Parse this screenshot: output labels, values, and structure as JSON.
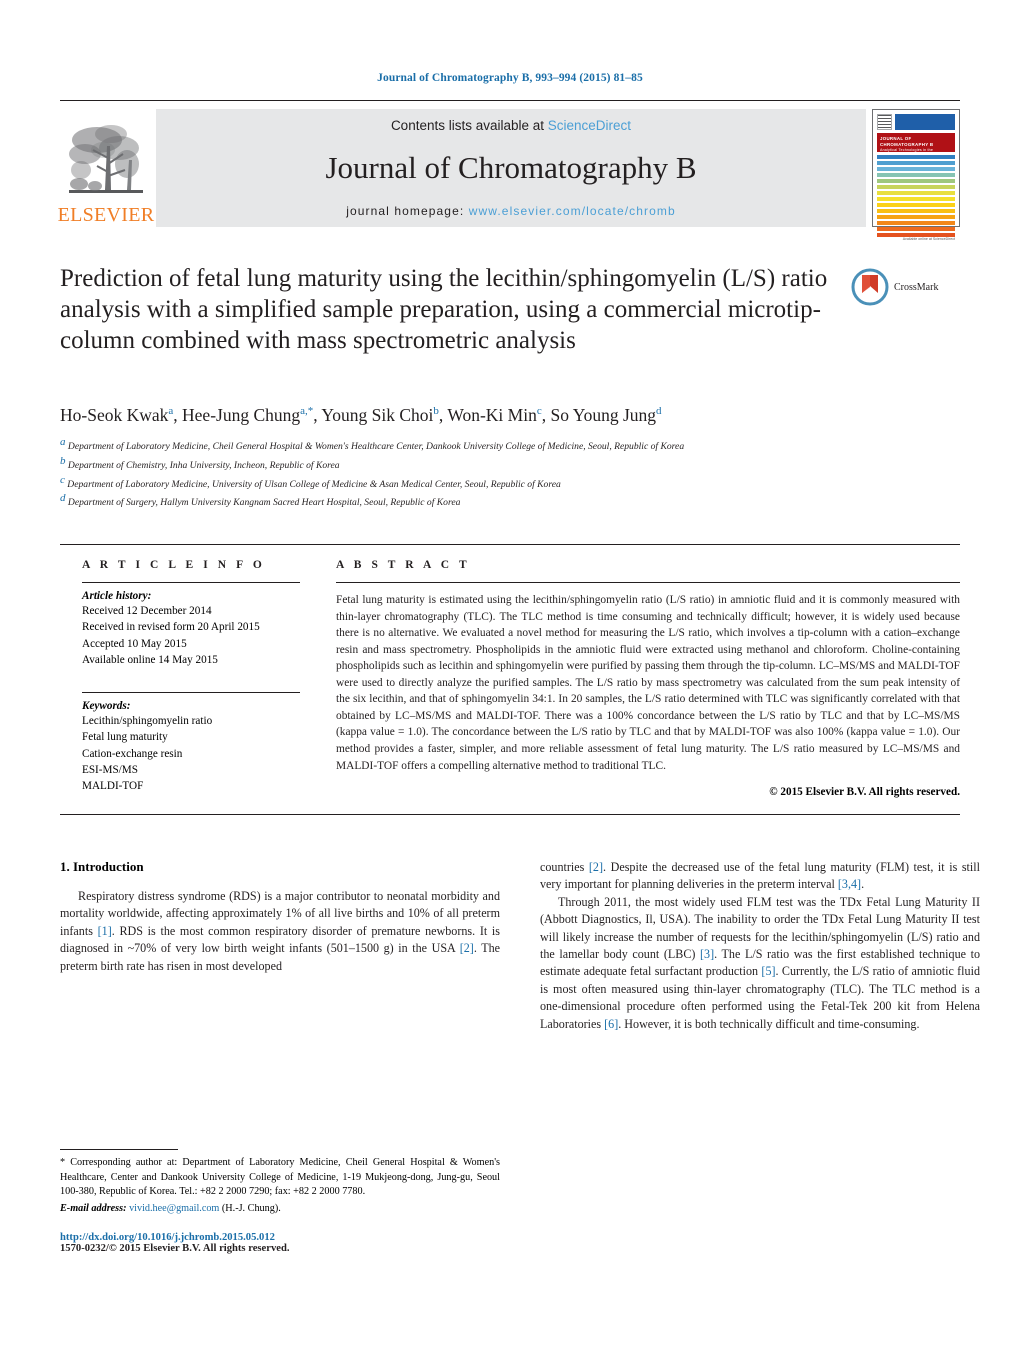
{
  "running_head": "Journal of Chromatography B, 993–994 (2015) 81–85",
  "masthead": {
    "publisher": "ELSEVIER",
    "contents_prefix": "Contents lists available at ",
    "contents_link": "ScienceDirect",
    "journal_name": "Journal of Chromatography B",
    "homepage_prefix": "journal homepage: ",
    "homepage_url": "www.elsevier.com/locate/chromb",
    "cover": {
      "banner_title": "JOURNAL OF CHROMATOGRAPHY B",
      "banner_subtitle": "Analytical Technologies in the Biomedical and Life Sciences",
      "footer_text": "Available online at ScienceDirect"
    }
  },
  "article": {
    "title": "Prediction of fetal lung maturity using the lecithin/sphingomyelin (L/S) ratio analysis with a simplified sample preparation, using a commercial microtip-column combined with mass spectrometric analysis",
    "crossmark_label": "CrossMark",
    "authors": [
      {
        "name": "Ho-Seok Kwak",
        "sup": "a"
      },
      {
        "name": "Hee-Jung Chung",
        "sup": "a,*"
      },
      {
        "name": "Young Sik Choi",
        "sup": "b"
      },
      {
        "name": "Won-Ki Min",
        "sup": "c"
      },
      {
        "name": "So Young Jung",
        "sup": "d"
      }
    ],
    "affiliations": [
      {
        "marker": "a",
        "text": "Department of Laboratory Medicine, Cheil General Hospital & Women's Healthcare Center, Dankook University College of Medicine, Seoul, Republic of Korea"
      },
      {
        "marker": "b",
        "text": "Department of Chemistry, Inha University, Incheon, Republic of Korea"
      },
      {
        "marker": "c",
        "text": "Department of Laboratory Medicine, University of Ulsan College of Medicine & Asan Medical Center, Seoul, Republic of Korea"
      },
      {
        "marker": "d",
        "text": "Department of Surgery, Hallym University Kangnam Sacred Heart Hospital, Seoul, Republic of Korea"
      }
    ]
  },
  "article_info": {
    "heading": "A R T I C L E  I N F O",
    "history_label": "Article history:",
    "history": [
      "Received 12 December 2014",
      "Received in revised form 20 April 2015",
      "Accepted 10 May 2015",
      "Available online 14 May 2015"
    ],
    "keywords_label": "Keywords:",
    "keywords": [
      "Lecithin/sphingomyelin ratio",
      "Fetal lung maturity",
      "Cation-exchange resin",
      "ESI-MS/MS",
      "MALDI-TOF"
    ]
  },
  "abstract": {
    "heading": "A B S T R A C T",
    "text": "Fetal lung maturity is estimated using the lecithin/sphingomyelin ratio (L/S ratio) in amniotic fluid and it is commonly measured with thin-layer chromatography (TLC). The TLC method is time consuming and technically difficult; however, it is widely used because there is no alternative. We evaluated a novel method for measuring the L/S ratio, which involves a tip-column with a cation–exchange resin and mass spectrometry. Phospholipids in the amniotic fluid were extracted using methanol and chloroform. Choline-containing phospholipids such as lecithin and sphingomyelin were purified by passing them through the tip-column. LC–MS/MS and MALDI-TOF were used to directly analyze the purified samples. The L/S ratio by mass spectrometry was calculated from the sum peak intensity of the six lecithin, and that of sphingomyelin 34:1. In 20 samples, the L/S ratio determined with TLC was significantly correlated with that obtained by LC–MS/MS and MALDI-TOF. There was a 100% concordance between the L/S ratio by TLC and that by LC–MS/MS (kappa value = 1.0). The concordance between the L/S ratio by TLC and that by MALDI-TOF was also 100% (kappa value = 1.0). Our method provides a faster, simpler, and more reliable assessment of fetal lung maturity. The L/S ratio measured by LC–MS/MS and MALDI-TOF offers a compelling alternative method to traditional TLC.",
    "copyright": "© 2015 Elsevier B.V. All rights reserved."
  },
  "body": {
    "section_number_title": "1.  Introduction",
    "left_paragraph_1_a": "Respiratory distress syndrome (RDS) is a major contributor to neonatal morbidity and mortality worldwide, affecting approximately 1% of all live births and 10% of all preterm infants ",
    "left_ref_1": "[1]",
    "left_paragraph_1_b": ". RDS is the most common respiratory disorder of premature newborns. It is diagnosed in ~70% of very low birth weight infants (501–1500 g) in the USA ",
    "left_ref_2": "[2]",
    "left_paragraph_1_c": ". The preterm birth rate has risen in most developed",
    "right_paragraph_1_a": "countries ",
    "right_ref_2": "[2]",
    "right_paragraph_1_b": ". Despite the decreased use of the fetal lung maturity (FLM) test, it is still very important for planning deliveries in the preterm interval ",
    "right_ref_34": "[3,4]",
    "right_paragraph_1_c": ".",
    "right_paragraph_2_a": "Through 2011, the most widely used FLM test was the TDx Fetal Lung Maturity II (Abbott Diagnostics, Il, USA). The inability to order the TDx Fetal Lung Maturity II test will likely increase the number of requests for the lecithin/sphingomyelin (L/S) ratio and the lamellar body count (LBC) ",
    "right_ref_3": "[3]",
    "right_paragraph_2_b": ". The L/S ratio was the first established technique to estimate adequate fetal surfactant production ",
    "right_ref_5": "[5]",
    "right_paragraph_2_c": ". Currently, the L/S ratio of amniotic fluid is most often measured using thin-layer chromatography (TLC). The TLC method is a one-dimensional procedure often performed using the Fetal-Tek 200 kit from Helena Laboratories ",
    "right_ref_6": "[6]",
    "right_paragraph_2_d": ". However, it is both technically difficult and time-consuming."
  },
  "footnote": {
    "star": "*",
    "corresponding_text": "Corresponding author at: Department of Laboratory Medicine, Cheil General Hospital & Women's Healthcare, Center and Dankook University College of Medicine, 1-19 Mukjeong-dong, Jung-gu, Seoul 100-380, Republic of Korea. Tel.: +82 2 2000 7290; fax: +82 2 2000 7780.",
    "email_label": "E-mail address:",
    "email": "vivid.hee@gmail.com",
    "email_owner": "(H.-J. Chung).",
    "doi": "http://dx.doi.org/10.1016/j.jchromb.2015.05.012",
    "issn": "1570-0232/© 2015 Elsevier B.V. All rights reserved."
  },
  "colors": {
    "link_blue": "#1a6ea8",
    "sciencedirect_blue": "#4b9fd5",
    "elsevier_orange": "#f07e26",
    "cover_red": "#b01116"
  }
}
